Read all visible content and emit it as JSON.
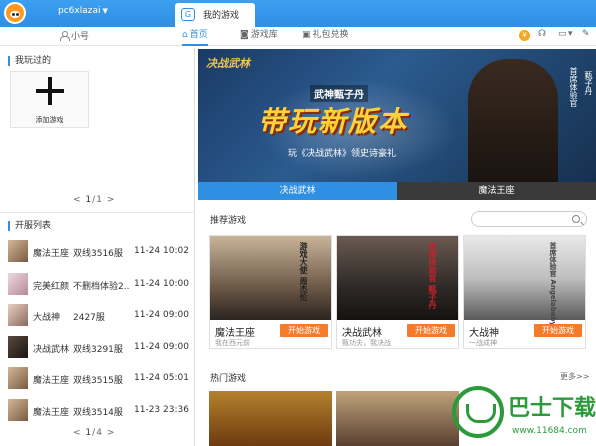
{
  "titlebar": {
    "username": "pc6xlazai",
    "active_tab": "我的游戏",
    "tab_badge": "G"
  },
  "toolbar": {
    "user_label": "小号",
    "nav": [
      {
        "label": "首页",
        "icon": "home-icon",
        "active": true
      },
      {
        "label": "游戏库",
        "icon": "gamepad-icon",
        "active": false
      },
      {
        "label": "礼包兑换",
        "icon": "gift-icon",
        "active": false
      }
    ],
    "coin": "¥"
  },
  "left": {
    "played_title": "我玩过的",
    "add_game_label": "添加游戏",
    "pager_played": {
      "prev": "<",
      "current": "1",
      "sep": "/",
      "total": "1",
      "next": ">"
    },
    "servers_title": "开服列表",
    "servers": [
      {
        "game": "魔法王座",
        "server": "双线3516服",
        "time": "11-24 10:02"
      },
      {
        "game": "完美红颜",
        "server": "不删档体验2...",
        "time": "11-24 10:00"
      },
      {
        "game": "大战神",
        "server": "2427服",
        "time": "11-24 09:00"
      },
      {
        "game": "决战武林",
        "server": "双线3291服",
        "time": "11-24 09:00"
      },
      {
        "game": "魔法王座",
        "server": "双线3515服",
        "time": "11-24 05:01"
      },
      {
        "game": "魔法王座",
        "server": "双线3514服",
        "time": "11-23 23:36"
      }
    ],
    "pager_servers": {
      "prev": "<",
      "current": "1",
      "sep": "/",
      "total": "4",
      "next": ">"
    }
  },
  "banner": {
    "brand": "决战武林",
    "headline_small": "武神甄子丹",
    "headline_big": "带玩新版本",
    "subline": "玩《决战武林》领史诗豪礼",
    "side_text_1": "首席体验官",
    "side_text_2": "甄子丹",
    "tabs": [
      "决战武林",
      "魔法王座"
    ]
  },
  "recommended": {
    "title": "推荐游戏",
    "search_placeholder": "",
    "cards": [
      {
        "name": "魔法王座",
        "desc": "我在西元前",
        "button": "开始游戏",
        "overlay": "游戏大使 周杰伦"
      },
      {
        "name": "决战武林",
        "desc": "甄功夫，我决战",
        "button": "开始游戏",
        "overlay": "首席体验官 甄子丹"
      },
      {
        "name": "大战神",
        "desc": "一战成神",
        "button": "开始游戏",
        "overlay": "首席体验官 Angelababy"
      }
    ]
  },
  "hot": {
    "title": "热门游戏",
    "more": "更多>>"
  },
  "watermark": {
    "title": "巴士下载",
    "url": "www.11684.com"
  },
  "colors": {
    "accent": "#2f8fe3",
    "play_button": "#f57b2a",
    "title_bar": "#3c9ff0"
  }
}
